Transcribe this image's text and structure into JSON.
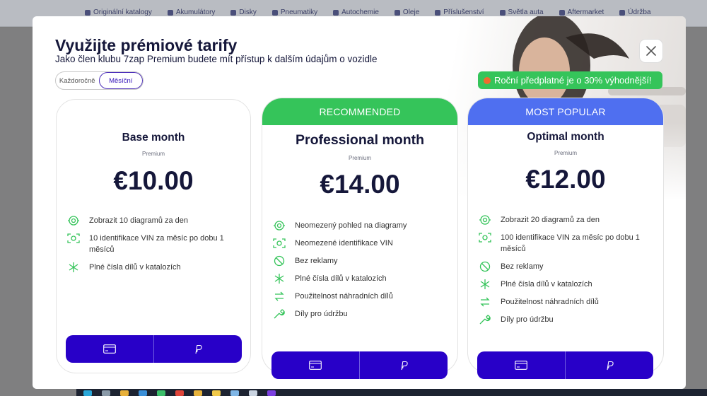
{
  "background": {
    "nav_items": [
      "Originální katalogy",
      "Akumulátory",
      "Disky",
      "Pneumatiky",
      "Autochemie",
      "Oleje",
      "Příslušenství",
      "Světla auta",
      "Aftermarket",
      "Údržba"
    ]
  },
  "modal": {
    "title": "Využijte prémiové tarify",
    "subtitle": "Jako člen klubu 7zap Premium budete mít přístup k dalším údajům o vozidle",
    "toggle": {
      "yearly": "Každoročně",
      "monthly": "Měsíční",
      "selected": "monthly"
    },
    "promo": "Roční předplatné je o 30% výhodnější!",
    "close_icon": "close-icon"
  },
  "plans": [
    {
      "name": "Base month",
      "tier": "Premium",
      "price": "€10.00",
      "badge": null,
      "features": [
        {
          "icon": "diagram-icon",
          "text": "Zobrazit 10 diagramů za den"
        },
        {
          "icon": "vin-scan-icon",
          "text": "10 identifikace VIN za měsíc po dobu 1 měsíců"
        },
        {
          "icon": "asterisk-icon",
          "text": "Plné čísla dílů v katalozích"
        }
      ]
    },
    {
      "name": "Professional month",
      "tier": "Premium",
      "price": "€14.00",
      "badge": "RECOMMENDED",
      "badge_color": "#35c45a",
      "features": [
        {
          "icon": "diagram-icon",
          "text": "Neomezený pohled na diagramy"
        },
        {
          "icon": "vin-scan-icon",
          "text": "Neomezené identifikace VIN"
        },
        {
          "icon": "no-ads-icon",
          "text": "Bez reklamy"
        },
        {
          "icon": "asterisk-icon",
          "text": "Plné čísla dílů v katalozích"
        },
        {
          "icon": "swap-icon",
          "text": "Použitelnost náhradních dílů"
        },
        {
          "icon": "wrench-icon",
          "text": "Díly pro údržbu"
        }
      ]
    },
    {
      "name": "Optimal month",
      "tier": "Premium",
      "price": "€12.00",
      "badge": "MOST POPULAR",
      "badge_color": "#4f6ff0",
      "features": [
        {
          "icon": "diagram-icon",
          "text": "Zobrazit 20 diagramů za den"
        },
        {
          "icon": "vin-scan-icon",
          "text": "100 identifikace VIN za měsíc po dobu 1 měsíců"
        },
        {
          "icon": "no-ads-icon",
          "text": "Bez reklamy"
        },
        {
          "icon": "asterisk-icon",
          "text": "Plné čísla dílů v katalozích"
        },
        {
          "icon": "swap-icon",
          "text": "Použitelnost náhradních dílů"
        },
        {
          "icon": "wrench-icon",
          "text": "Díly pro údržbu"
        }
      ]
    }
  ],
  "colors": {
    "accent_button": "#2800c8",
    "feature_icon": "#35c45a",
    "recommended": "#35c45a",
    "most_popular": "#4f6ff0"
  },
  "payment_icons": [
    "card-icon",
    "paypal-icon"
  ]
}
